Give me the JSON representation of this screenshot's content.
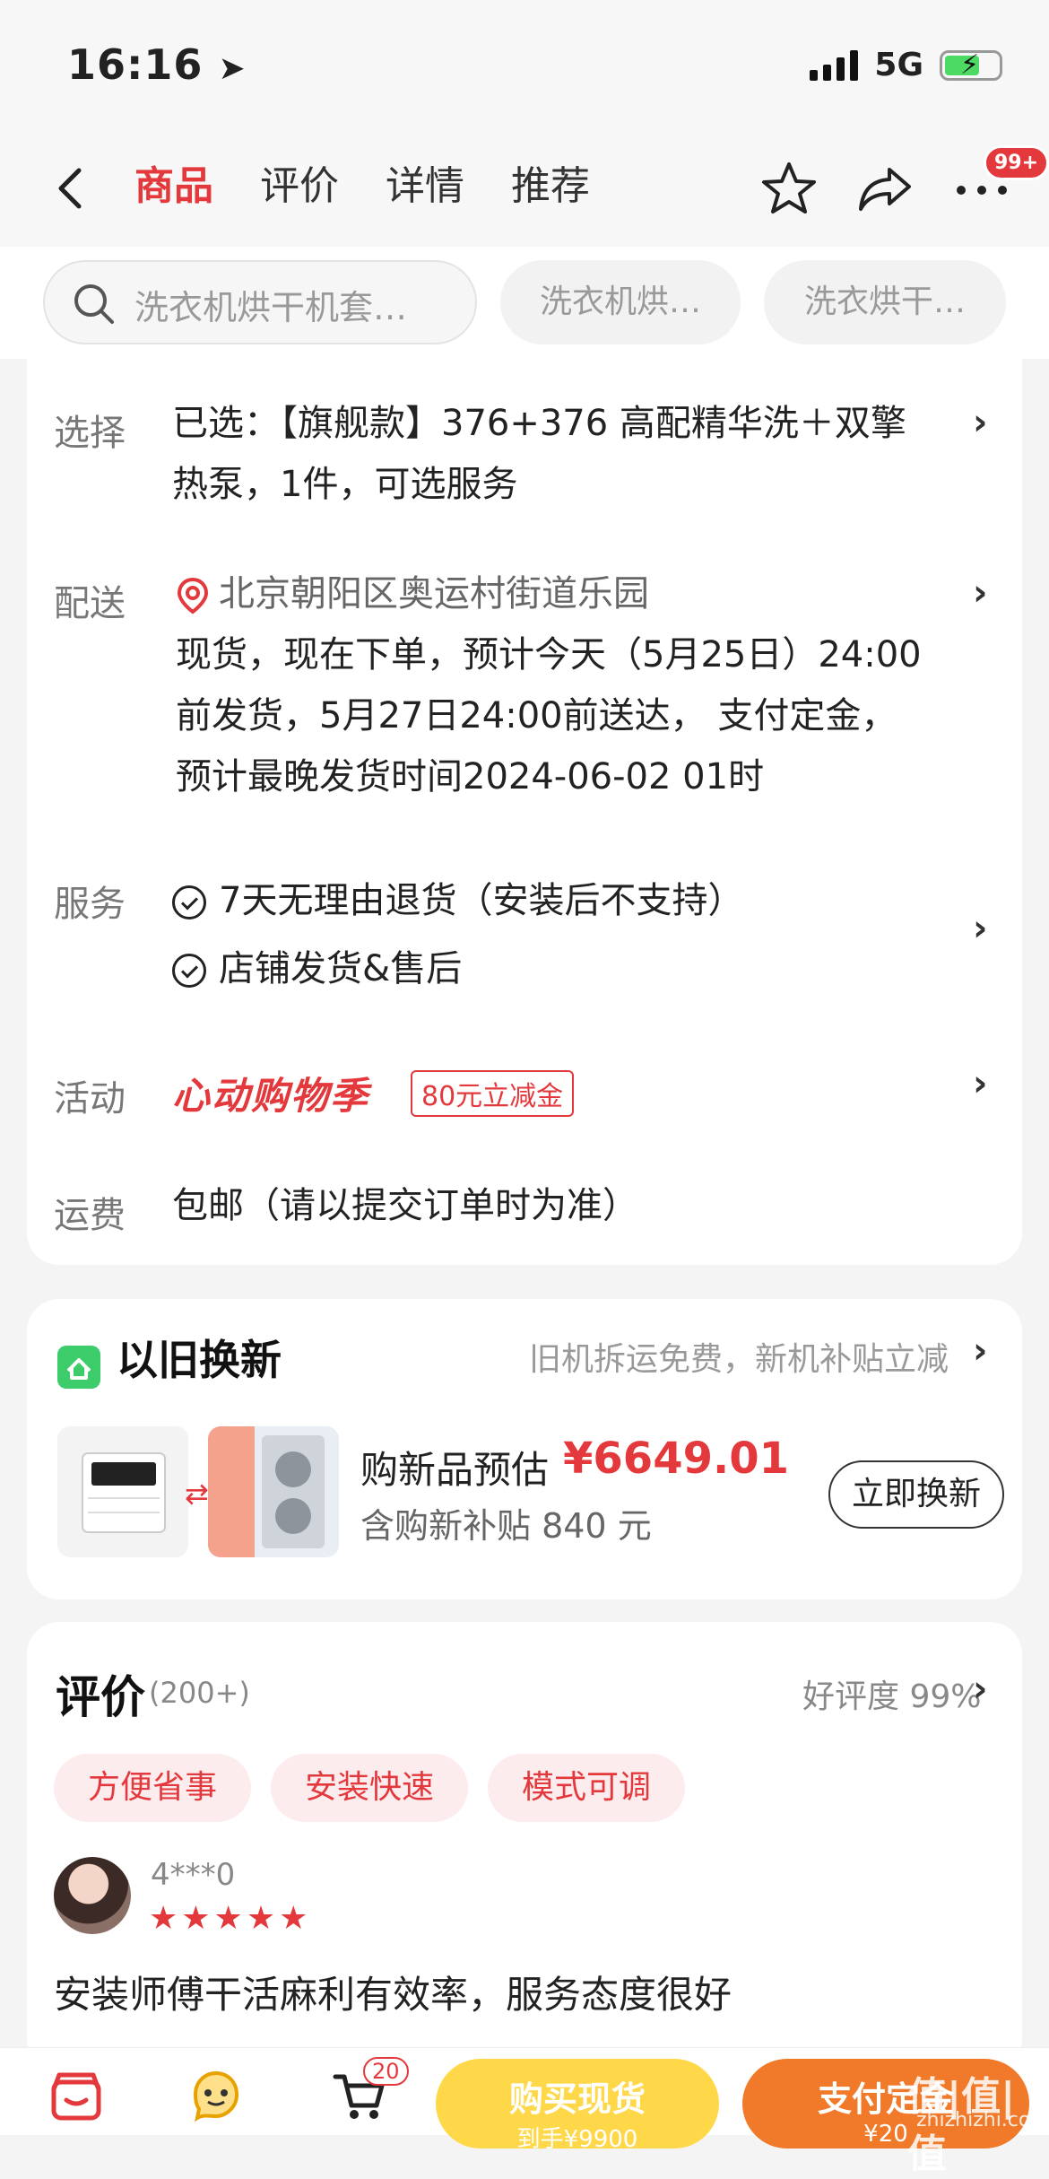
{
  "status": {
    "time": "16:16",
    "network": "5G"
  },
  "nav": {
    "tabs": [
      {
        "label": "商品",
        "active": true
      },
      {
        "label": "评价",
        "active": false
      },
      {
        "label": "详情",
        "active": false
      },
      {
        "label": "推荐",
        "active": false
      }
    ],
    "badge": "99+",
    "icons": [
      "chevron-left-icon",
      "star-icon",
      "share-icon",
      "more-icon"
    ]
  },
  "search": {
    "placeholder": "洗衣机烘干机套…",
    "chips": [
      "洗衣机烘…",
      "洗衣烘干…"
    ]
  },
  "details": {
    "select_label": "选择",
    "select_line1": "已选：【旗舰款】376+376 高配精华洗＋双擎",
    "select_line2": "热泵，1件，可选服务",
    "delivery_label": "配送",
    "address": "北京朝阳区奥运村街道乐园",
    "delivery_line1": "现货，现在下单，预计今天（5月25日）24:00",
    "delivery_line2": "前发货，5月27日24:00前送达， 支付定金，",
    "delivery_line3": "预计最晚发货时间2024-06-02 01时",
    "service_label": "服务",
    "service1": "7天无理由退货（安装后不支持）",
    "service2": "店铺发货&售后",
    "promo_label": "活动",
    "promo_logo": "心动购物季",
    "promo_tag": "80元立减金",
    "shipping_label": "运费",
    "shipping_value": "包邮（请以提交订单时为准）"
  },
  "tradein": {
    "title": "以旧换新",
    "subtitle": "旧机拆运免费，新机补贴立减",
    "estimate_label": "购新品预估",
    "estimate_price": "¥6649.01",
    "subsidy": "含购新补贴 840 元",
    "button": "立即换新"
  },
  "reviews": {
    "title": "评价",
    "count": "(200+)",
    "rate": "好评度 99%",
    "tags": [
      "方便省事",
      "安装快速",
      "模式可调"
    ],
    "reviewer": "4***0",
    "stars": "★★★★★",
    "text": "安装师傅干活麻利有效率，服务态度很好"
  },
  "bottom": {
    "cart_count": "20",
    "buy_label": "购买现货",
    "buy_sub": "到手¥9900",
    "deposit_label": "支付定金",
    "deposit_sub": "¥20",
    "watermark": "值|值|值",
    "watermark_site": "zhizhizhi.com"
  },
  "colors": {
    "accent": "#e4393c",
    "buy": "#ffd84a",
    "deposit": "#f07a2a"
  }
}
